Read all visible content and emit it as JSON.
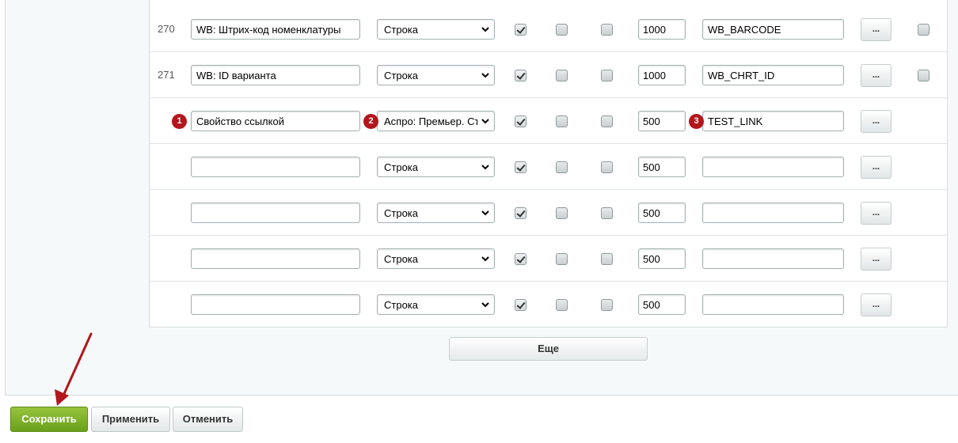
{
  "properties": {
    "rows": [
      {
        "id": "270",
        "name": "WB: Штрих-код номенклатуры",
        "name_placeholder": "",
        "type": "Строка",
        "checks": [
          true,
          false,
          false
        ],
        "size": "1000",
        "code": "WB_BARCODE",
        "dots": "...",
        "has_delete": true,
        "delete_checked": false
      },
      {
        "id": "271",
        "name": "WB: ID варианта",
        "name_placeholder": "",
        "type": "Строка",
        "checks": [
          true,
          false,
          false
        ],
        "size": "1000",
        "code": "WB_CHRT_ID",
        "dots": "...",
        "has_delete": true,
        "delete_checked": false
      },
      {
        "id": "",
        "name": "Свойство ссылкой",
        "name_placeholder": "",
        "type": "Аспро: Премьер. Ст",
        "checks": [
          true,
          false,
          false
        ],
        "size": "500",
        "code": "TEST_LINK",
        "dots": "...",
        "has_delete": false,
        "markers": [
          "1",
          "2",
          "3"
        ]
      },
      {
        "id": "",
        "name": "",
        "name_placeholder": "",
        "type": "Строка",
        "checks": [
          true,
          false,
          false
        ],
        "size": "500",
        "code": "",
        "dots": "...",
        "has_delete": false
      },
      {
        "id": "",
        "name": "",
        "name_placeholder": "",
        "type": "Строка",
        "checks": [
          true,
          false,
          false
        ],
        "size": "500",
        "code": "",
        "dots": "...",
        "has_delete": false
      },
      {
        "id": "",
        "name": "",
        "name_placeholder": "",
        "type": "Строка",
        "checks": [
          true,
          false,
          false
        ],
        "size": "500",
        "code": "",
        "dots": "...",
        "has_delete": false
      },
      {
        "id": "",
        "name": "",
        "name_placeholder": "",
        "type": "Строка",
        "checks": [
          true,
          false,
          false
        ],
        "size": "500",
        "code": "",
        "dots": "...",
        "has_delete": false
      }
    ],
    "more_label": "Еще"
  },
  "footer": {
    "save_label": "Сохранить",
    "apply_label": "Применить",
    "cancel_label": "Отменить"
  },
  "colors": {
    "marker": "#b3161d",
    "save_button": "#7fb22c",
    "annotation_arrow": "#b3161d"
  },
  "icons": {
    "select_arrow": "chevron-down-icon",
    "annotation": "red-arrow-icon"
  }
}
